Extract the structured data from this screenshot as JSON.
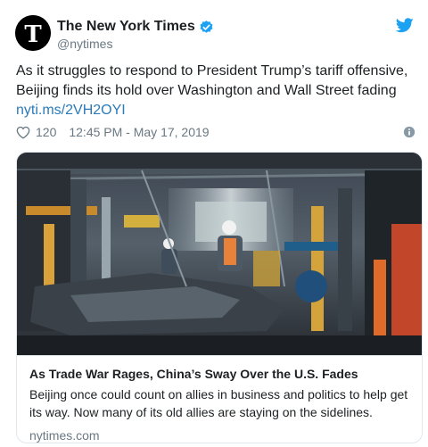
{
  "author": {
    "display_name": "The New York Times",
    "handle": "@nytimes",
    "avatar_icon": "nyt-logo-icon",
    "verified_icon": "verified-badge-icon"
  },
  "brand_icon": "twitter-bird-icon",
  "tweet": {
    "text": "As it struggles to respond to President Trump’s tariff offensive, Beijing finds its hold over Washington and Wall Street fading",
    "link": "nyti.ms/2VH2OYI",
    "likes": "120",
    "timestamp": "12:45 PM - May 17, 2019"
  },
  "card": {
    "title": "As Trade War Rages, China’s Sway Over the U.S. Fades",
    "description": "Beijing once could count on allies in business and politics to help get its way. Now many of its old allies are staying on the sidelines.",
    "domain": "nytimes.com"
  },
  "colors": {
    "link": "#2b7bb9",
    "twitter_blue": "#1da1f2",
    "muted": "#697882",
    "border": "#e1e8ed"
  }
}
